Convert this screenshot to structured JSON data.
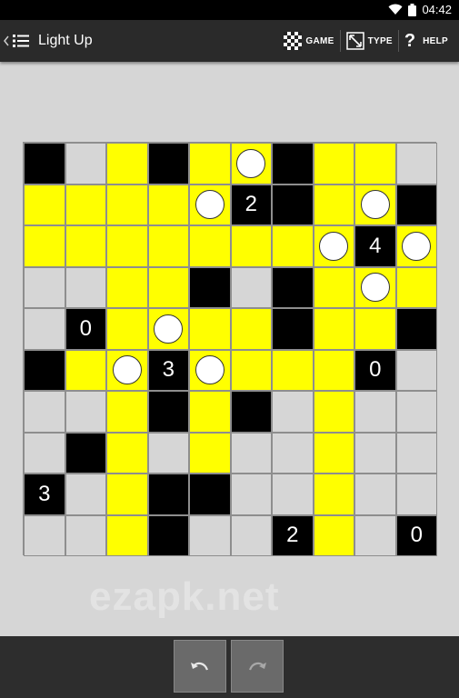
{
  "status_bar": {
    "time": "04:42"
  },
  "action_bar": {
    "title": "Light Up",
    "actions": [
      {
        "label": "GAME",
        "icon": "checkerboard-icon"
      },
      {
        "label": "TYPE",
        "icon": "resize-icon"
      },
      {
        "label": "HELP",
        "icon": "help-icon"
      }
    ]
  },
  "puzzle": {
    "rows": 10,
    "cols": 10,
    "legend": "e=empty, l=lit, b=black wall (optional number), o=bulb on lit cell",
    "grid": [
      [
        "b",
        "e",
        "l",
        "b",
        "l",
        "o",
        "b",
        "l",
        "l",
        "e"
      ],
      [
        "l",
        "l",
        "l",
        "l",
        "o",
        "b2",
        "b",
        "l",
        "o",
        "b"
      ],
      [
        "l",
        "l",
        "l",
        "l",
        "l",
        "l",
        "l",
        "o",
        "b4",
        "o"
      ],
      [
        "e",
        "e",
        "l",
        "l",
        "b",
        "e",
        "b",
        "l",
        "o",
        "l"
      ],
      [
        "e",
        "b0",
        "l",
        "o",
        "l",
        "l",
        "b",
        "l",
        "l",
        "b"
      ],
      [
        "b",
        "l",
        "o",
        "b3",
        "o",
        "l",
        "l",
        "l",
        "b0",
        "e"
      ],
      [
        "e",
        "e",
        "l",
        "b",
        "l",
        "b",
        "e",
        "l",
        "e",
        "e"
      ],
      [
        "e",
        "b",
        "l",
        "e",
        "l",
        "e",
        "e",
        "l",
        "e",
        "e"
      ],
      [
        "b3",
        "e",
        "l",
        "b",
        "b",
        "e",
        "e",
        "l",
        "e",
        "e"
      ],
      [
        "e",
        "e",
        "l",
        "b",
        "e",
        "e",
        "b2",
        "l",
        "e",
        "b0"
      ]
    ]
  },
  "watermark": "ezapk.net",
  "bottom_bar": {
    "buttons": [
      {
        "name": "undo-button",
        "icon": "undo-icon"
      },
      {
        "name": "redo-button",
        "icon": "redo-icon"
      }
    ]
  },
  "colors": {
    "lit": "#ffff00",
    "empty": "#d6d6d6",
    "wall": "#000000",
    "bar": "#2a2a2a"
  }
}
